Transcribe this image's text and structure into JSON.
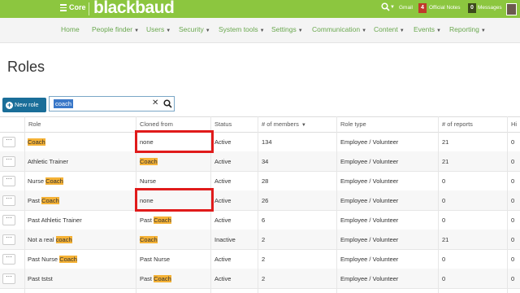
{
  "header": {
    "core_label": "Core",
    "logo_text": "blackbaud",
    "gmail_label": "Gmail",
    "official_notes_count": "4",
    "official_notes_label": "Official Notes",
    "messages_count": "0",
    "messages_label": "Messages",
    "brand_color": "#8cc63f"
  },
  "nav": {
    "items": [
      {
        "label": "Home"
      },
      {
        "label": "People finder"
      },
      {
        "label": "Users"
      },
      {
        "label": "Security"
      },
      {
        "label": "System tools"
      },
      {
        "label": "Settings"
      },
      {
        "label": "Communication"
      },
      {
        "label": "Content"
      },
      {
        "label": "Events"
      },
      {
        "label": "Reporting"
      }
    ]
  },
  "page": {
    "title": "Roles",
    "new_role_label": "New role",
    "search_value": "coach"
  },
  "table": {
    "headers": [
      "Role",
      "Cloned from",
      "Status",
      "# of members",
      "Role type",
      "# of reports",
      "Hi"
    ],
    "rows": [
      {
        "role_pre": "",
        "role_hl": "Coach",
        "cloned_pre": "none",
        "cloned_hl": "",
        "status": "Active",
        "members": "134",
        "role_type": "Employee / Volunteer",
        "reports": "21",
        "hi": "0"
      },
      {
        "role_pre": "Athletic Trainer",
        "role_hl": "",
        "cloned_pre": "",
        "cloned_hl": "Coach",
        "status": "Active",
        "members": "34",
        "role_type": "Employee / Volunteer",
        "reports": "21",
        "hi": "0"
      },
      {
        "role_pre": "Nurse ",
        "role_hl": "Coach",
        "cloned_pre": "Nurse",
        "cloned_hl": "",
        "status": "Active",
        "members": "28",
        "role_type": "Employee / Volunteer",
        "reports": "0",
        "hi": "0"
      },
      {
        "role_pre": "Past ",
        "role_hl": "Coach",
        "cloned_pre": "none",
        "cloned_hl": "",
        "status": "Active",
        "members": "26",
        "role_type": "Employee / Volunteer",
        "reports": "0",
        "hi": "0"
      },
      {
        "role_pre": "Past Athletic Trainer",
        "role_hl": "",
        "cloned_pre": "Past ",
        "cloned_hl": "Coach",
        "status": "Active",
        "members": "6",
        "role_type": "Employee / Volunteer",
        "reports": "0",
        "hi": "0"
      },
      {
        "role_pre": "Not a real ",
        "role_hl": "coach",
        "cloned_pre": "",
        "cloned_hl": "Coach",
        "status": "Inactive",
        "members": "2",
        "role_type": "Employee / Volunteer",
        "reports": "21",
        "hi": "0"
      },
      {
        "role_pre": "Past Nurse ",
        "role_hl": "Coach",
        "cloned_pre": "Past Nurse",
        "cloned_hl": "",
        "status": "Active",
        "members": "2",
        "role_type": "Employee / Volunteer",
        "reports": "0",
        "hi": "0"
      },
      {
        "role_pre": "Past tstst",
        "role_hl": "",
        "cloned_pre": "Past ",
        "cloned_hl": "Coach",
        "status": "Active",
        "members": "2",
        "role_type": "Employee / Volunteer",
        "reports": "0",
        "hi": "0"
      }
    ]
  }
}
